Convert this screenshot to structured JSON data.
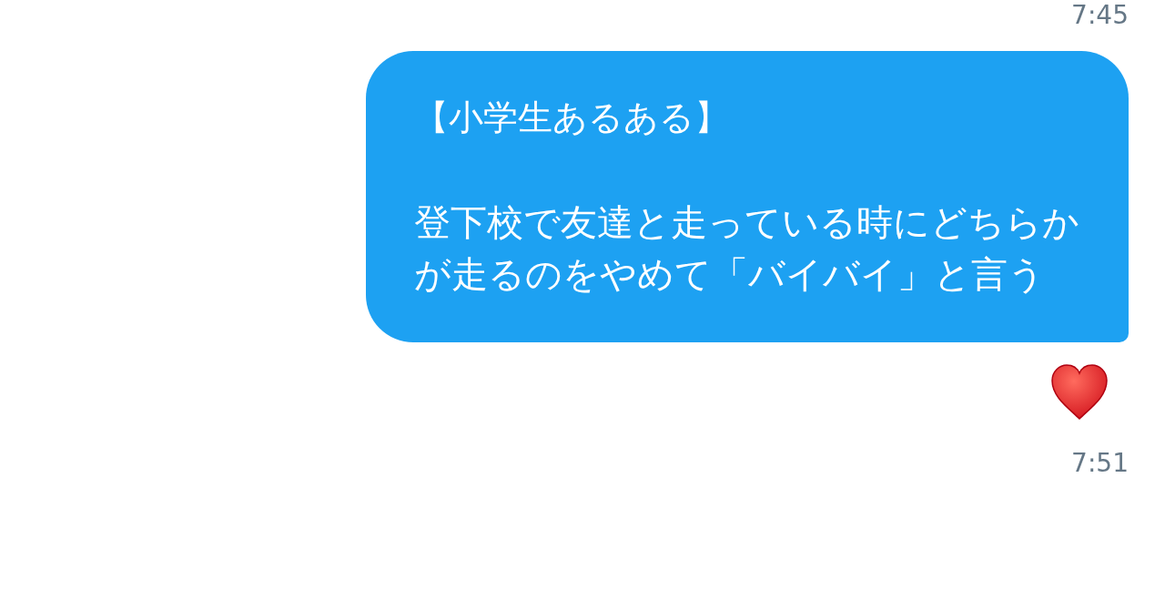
{
  "earlier_timestamp": "7:45",
  "message": {
    "title": "【小学生あるある】",
    "body": "登下校で友達と走っている時にどちらかが走るのをやめて「バイバイ」と言う",
    "liked": true,
    "timestamp": "7:51"
  }
}
